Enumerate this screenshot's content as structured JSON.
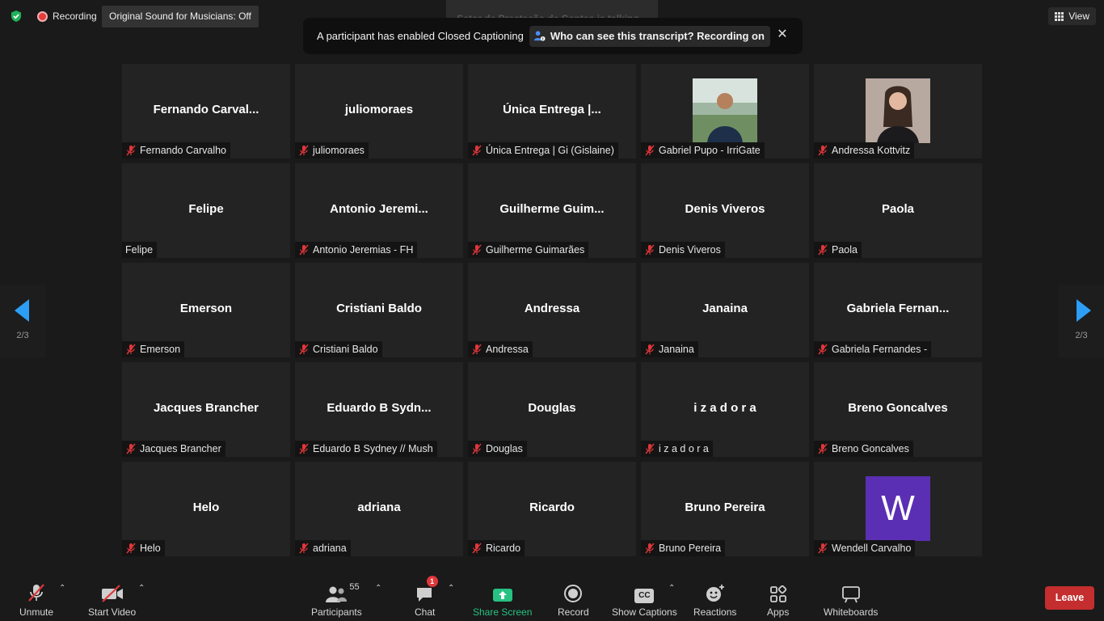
{
  "topbar": {
    "recording_label": "Recording",
    "original_sound": "Original Sound for Musicians: Off",
    "talking": "Setor de Prestação de Contas is talking...",
    "view_label": "View"
  },
  "cc_banner": {
    "message": "A participant has enabled Closed Captioning",
    "who_label": "Who can see this transcript? Recording on",
    "close_glyph": "✕"
  },
  "gallery": {
    "page_indicator": "2/3",
    "tiles": [
      {
        "display": "Fernando  Carval...",
        "label": "Fernando Carvalho",
        "muted": true
      },
      {
        "display": "juliomoraes",
        "label": "juliomoraes",
        "muted": true
      },
      {
        "display": "Única  Entrega  |...",
        "label": "Única Entrega | Gi (Gislaine)",
        "muted": true
      },
      {
        "display": "",
        "label": "Gabriel Pupo - IrriGate",
        "muted": true,
        "photo": "man-outdoor-photo"
      },
      {
        "display": "",
        "label": "Andressa Kottvitz",
        "muted": true,
        "photo": "woman-portrait-photo"
      },
      {
        "display": "Felipe",
        "label": "Felipe",
        "muted": false
      },
      {
        "display": "Antonio  Jeremi...",
        "label": "Antonio Jeremias - FH",
        "muted": true
      },
      {
        "display": "Guilherme  Guim...",
        "label": "Guilherme Guimarães",
        "muted": true
      },
      {
        "display": "Denis Viveros",
        "label": "Denis Viveros",
        "muted": true
      },
      {
        "display": "Paola",
        "label": "Paola",
        "muted": true
      },
      {
        "display": "Emerson",
        "label": "Emerson",
        "muted": true
      },
      {
        "display": "Cristiani Baldo",
        "label": "Cristiani Baldo",
        "muted": true
      },
      {
        "display": "Andressa",
        "label": "Andressa",
        "muted": true
      },
      {
        "display": "Janaina",
        "label": "Janaina",
        "muted": true
      },
      {
        "display": "Gabriela  Fernan...",
        "label": "Gabriela Fernandes -",
        "muted": true
      },
      {
        "display": "Jacques Brancher",
        "label": "Jacques Brancher",
        "muted": true
      },
      {
        "display": "Eduardo  B  Sydn...",
        "label": "Eduardo B Sydney // Mush",
        "muted": true
      },
      {
        "display": "Douglas",
        "label": "Douglas",
        "muted": true
      },
      {
        "display": "i z a d o r a",
        "label": "i z a d o r a",
        "muted": true
      },
      {
        "display": "Breno Goncalves",
        "label": "Breno Goncalves",
        "muted": true
      },
      {
        "display": "Helo",
        "label": "Helo",
        "muted": true
      },
      {
        "display": "adriana",
        "label": "adriana",
        "muted": true
      },
      {
        "display": "Ricardo",
        "label": "Ricardo",
        "muted": true
      },
      {
        "display": "Bruno Pereira",
        "label": "Bruno Pereira",
        "muted": true
      },
      {
        "display": "",
        "label": "Wendell Carvalho",
        "muted": true,
        "avatar_letter": "W",
        "avatar_color": "#5b2fb3"
      }
    ]
  },
  "toolbar": {
    "unmute": "Unmute",
    "start_video": "Start Video",
    "participants": "Participants",
    "participants_count": "55",
    "chat": "Chat",
    "chat_badge": "1",
    "share_screen": "Share Screen",
    "record": "Record",
    "show_captions": "Show Captions",
    "cc_glyph": "CC",
    "reactions": "Reactions",
    "apps": "Apps",
    "whiteboards": "Whiteboards",
    "leave": "Leave",
    "caret_glyph": "⌃"
  },
  "colors": {
    "accent_blue": "#2d9ef5",
    "share_green": "#26c281",
    "leave_red": "#c42e2e",
    "muted_red": "#e0363a",
    "security_green": "#1fb25a"
  }
}
